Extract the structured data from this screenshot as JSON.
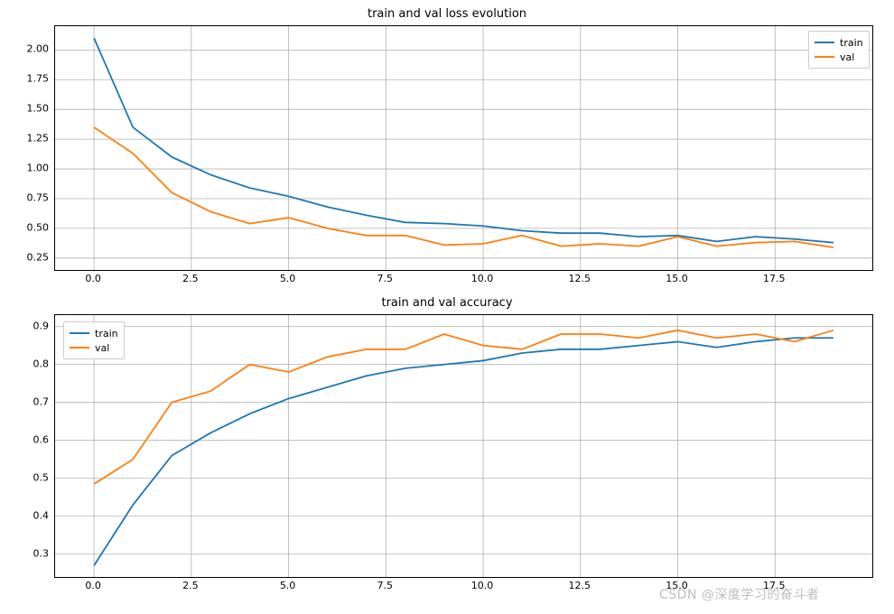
{
  "colors": {
    "train": "#1f77b4",
    "val": "#ff7f0e",
    "grid": "#b0b0b0",
    "axis": "#000000"
  },
  "watermark": "CSDN @深度学习的奋斗者",
  "chart_data": [
    {
      "type": "line",
      "title": "train and val loss evolution",
      "xlabel": "",
      "ylabel": "",
      "xlim": [
        -1.0,
        20.0
      ],
      "ylim": [
        0.15,
        2.2
      ],
      "xticks": [
        0.0,
        2.5,
        5.0,
        7.5,
        10.0,
        12.5,
        15.0,
        17.5
      ],
      "yticks": [
        0.25,
        0.5,
        0.75,
        1.0,
        1.25,
        1.5,
        1.75,
        2.0
      ],
      "legend_position": "upper right",
      "x": [
        0,
        1,
        2,
        3,
        4,
        5,
        6,
        7,
        8,
        9,
        10,
        11,
        12,
        13,
        14,
        15,
        16,
        17,
        18,
        19
      ],
      "series": [
        {
          "name": "train",
          "values": [
            2.1,
            1.35,
            1.1,
            0.95,
            0.84,
            0.77,
            0.68,
            0.61,
            0.55,
            0.54,
            0.52,
            0.48,
            0.46,
            0.46,
            0.43,
            0.44,
            0.39,
            0.43,
            0.41,
            0.38
          ]
        },
        {
          "name": "val",
          "values": [
            1.35,
            1.13,
            0.8,
            0.64,
            0.54,
            0.59,
            0.5,
            0.44,
            0.44,
            0.36,
            0.37,
            0.44,
            0.35,
            0.37,
            0.35,
            0.43,
            0.35,
            0.38,
            0.39,
            0.34
          ]
        }
      ]
    },
    {
      "type": "line",
      "title": "train and val accuracy",
      "xlabel": "",
      "ylabel": "",
      "xlim": [
        -1.0,
        20.0
      ],
      "ylim": [
        0.24,
        0.93
      ],
      "xticks": [
        0.0,
        2.5,
        5.0,
        7.5,
        10.0,
        12.5,
        15.0,
        17.5
      ],
      "yticks": [
        0.3,
        0.4,
        0.5,
        0.6,
        0.7,
        0.8,
        0.9
      ],
      "legend_position": "upper left",
      "x": [
        0,
        1,
        2,
        3,
        4,
        5,
        6,
        7,
        8,
        9,
        10,
        11,
        12,
        13,
        14,
        15,
        16,
        17,
        18,
        19
      ],
      "series": [
        {
          "name": "train",
          "values": [
            0.27,
            0.43,
            0.56,
            0.62,
            0.67,
            0.71,
            0.74,
            0.77,
            0.79,
            0.8,
            0.81,
            0.83,
            0.84,
            0.84,
            0.85,
            0.86,
            0.845,
            0.86,
            0.87,
            0.87
          ]
        },
        {
          "name": "val",
          "values": [
            0.485,
            0.55,
            0.7,
            0.73,
            0.8,
            0.78,
            0.82,
            0.84,
            0.84,
            0.88,
            0.85,
            0.84,
            0.88,
            0.88,
            0.87,
            0.89,
            0.87,
            0.88,
            0.86,
            0.89
          ]
        }
      ]
    }
  ]
}
